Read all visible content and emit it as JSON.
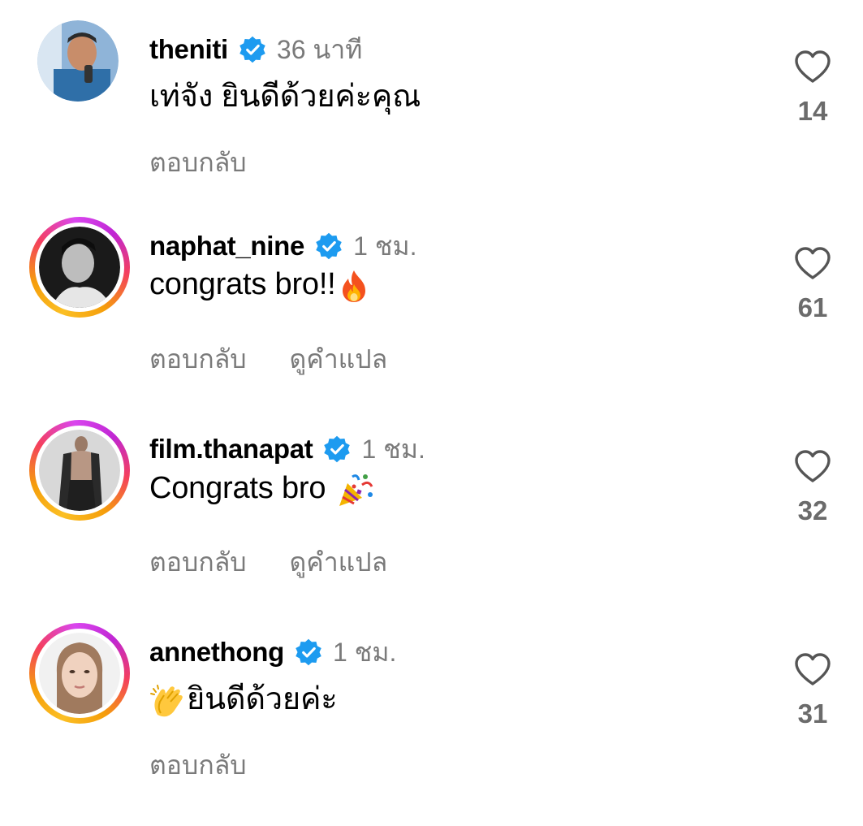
{
  "colors": {
    "verified": "#1d9bf0",
    "muted": "#7a7a7a",
    "text": "#000000"
  },
  "comments": [
    {
      "username": "theniti",
      "time": "36 นาที",
      "text": "เท่จัง ยินดีด้วยค่ะคุณ",
      "reply": "ตอบกลับ",
      "translate": "",
      "likes": "14",
      "story_ring": false,
      "emoji_icon": ""
    },
    {
      "username": "naphat_nine",
      "time": "1 ชม.",
      "text": "congrats bro!!",
      "reply": "ตอบกลับ",
      "translate": "ดูคำแปล",
      "likes": "61",
      "story_ring": true,
      "emoji_icon": "fire-emoji-icon"
    },
    {
      "username": "film.thanapat",
      "time": "1 ชม.",
      "text": "Congrats bro ",
      "reply": "ตอบกลับ",
      "translate": "ดูคำแปล",
      "likes": "32",
      "story_ring": true,
      "emoji_icon": "party-popper-emoji-icon"
    },
    {
      "username": "annethong",
      "time": "1 ชม.",
      "text": "ยินดีด้วยค่ะ",
      "reply": "ตอบกลับ",
      "translate": "",
      "likes": "31",
      "story_ring": true,
      "emoji_icon": "clapping-hands-emoji-icon"
    }
  ]
}
